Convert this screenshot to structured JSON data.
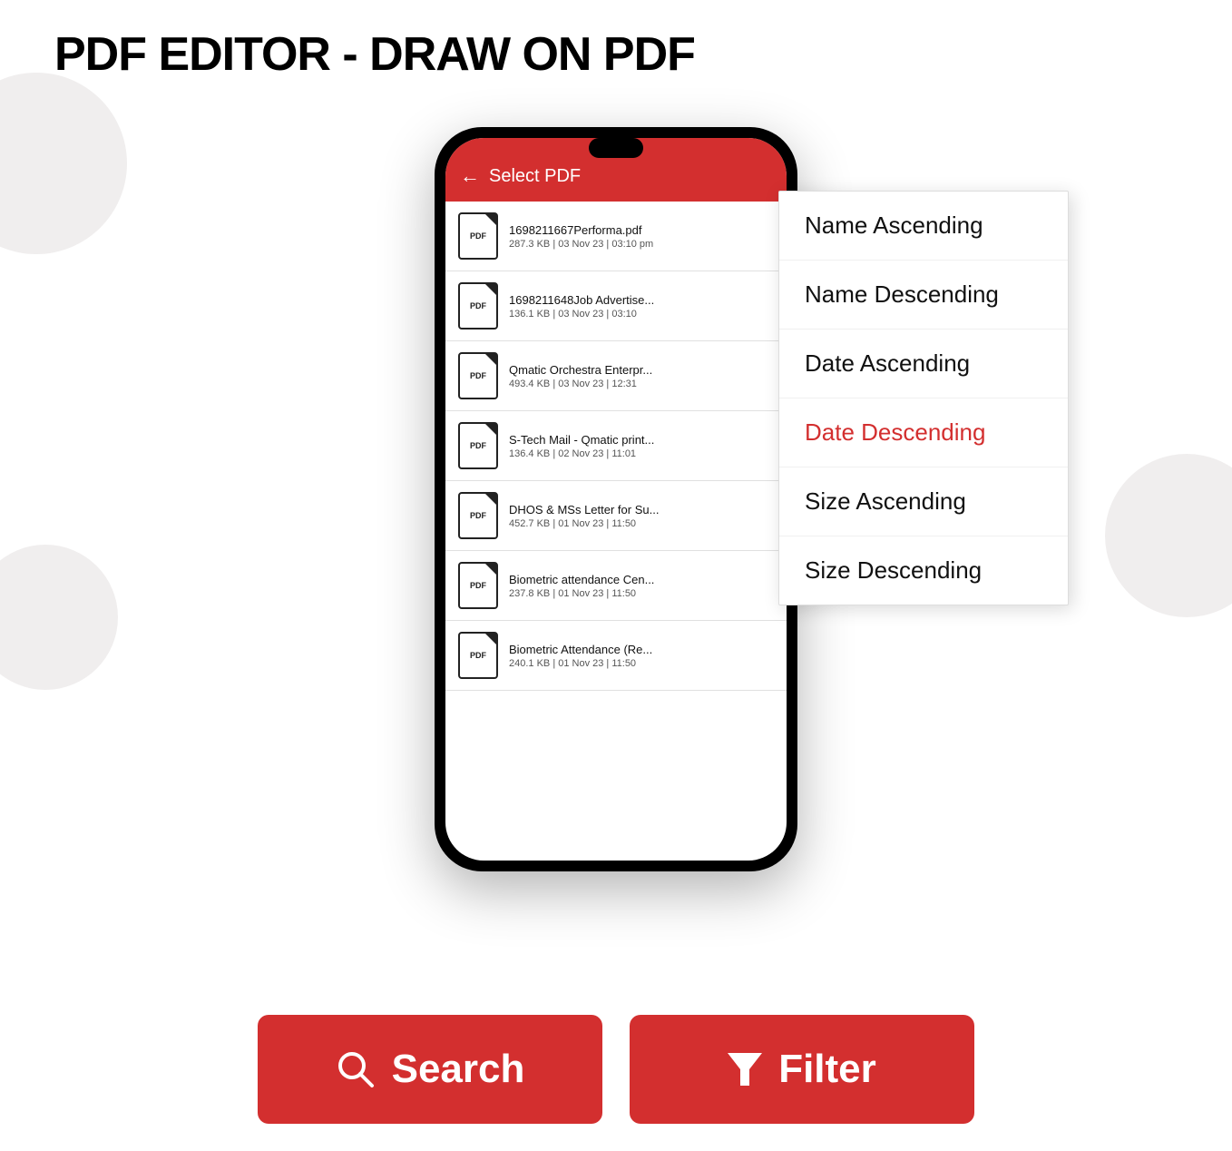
{
  "page": {
    "title": "PDF EDITOR - DRAW ON PDF",
    "background": "#ffffff"
  },
  "phone": {
    "header": {
      "back_icon": "←",
      "title": "Select PDF"
    },
    "files": [
      {
        "name": "1698211667Performa.pdf",
        "meta": "287.3 KB  |  03 Nov 23 | 03:10 pm"
      },
      {
        "name": "1698211648Job Advertise...",
        "meta": "136.1 KB  |  03 Nov 23 | 03:10"
      },
      {
        "name": "Qmatic Orchestra Enterpr...",
        "meta": "493.4 KB  |  03 Nov 23 | 12:31"
      },
      {
        "name": "S-Tech Mail - Qmatic print...",
        "meta": "136.4 KB  |  02 Nov 23 | 11:01"
      },
      {
        "name": "DHOS & MSs Letter for Su...",
        "meta": "452.7 KB  |  01 Nov 23 | 11:50"
      },
      {
        "name": "Biometric attendance Cen...",
        "meta": "237.8 KB  |  01 Nov 23 | 11:50"
      },
      {
        "name": "Biometric Attendance (Re...",
        "meta": "240.1 KB  |  01 Nov 23 | 11:50"
      }
    ],
    "file_icon_label": "PDF"
  },
  "sort_menu": {
    "items": [
      {
        "label": "Name Ascending",
        "active": false
      },
      {
        "label": "Name Descending",
        "active": false
      },
      {
        "label": "Date Ascending",
        "active": false
      },
      {
        "label": "Date Descending",
        "active": true
      },
      {
        "label": "Size Ascending",
        "active": false
      },
      {
        "label": "Size Descending",
        "active": false
      }
    ]
  },
  "buttons": {
    "search": {
      "label": "Search",
      "icon": "search"
    },
    "filter": {
      "label": "Filter",
      "icon": "filter"
    }
  }
}
